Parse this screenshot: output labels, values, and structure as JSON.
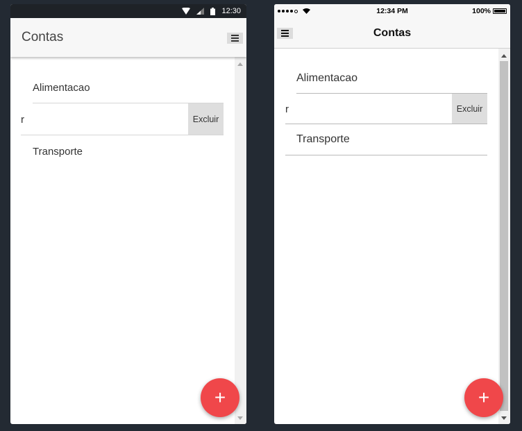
{
  "android": {
    "status_time": "12:30",
    "title": "Contas",
    "menu_icon": "hamburger-menu-icon",
    "items": [
      {
        "label": "Alimentacao"
      },
      {
        "label": "",
        "swiped": true,
        "partial_label": "r",
        "action_label": "Excluir"
      },
      {
        "label": "Transporte"
      }
    ],
    "fab_symbol": "+",
    "colors": {
      "statusbar": "#1e2227",
      "appbar": "#f7f7f7",
      "fab": "#f0474a",
      "action_bg": "#dedede"
    }
  },
  "ios": {
    "status_time": "12:34 PM",
    "battery_text": "100%",
    "title": "Contas",
    "menu_icon": "hamburger-menu-icon",
    "items": [
      {
        "label": "Alimentacao"
      },
      {
        "label": "",
        "swiped": true,
        "partial_label": "r",
        "action_label": "Excluir"
      },
      {
        "label": "Transporte"
      }
    ],
    "fab_symbol": "+",
    "colors": {
      "navbar": "#f7f7f7",
      "fab": "#f0474a",
      "action_bg": "#dedede"
    }
  }
}
